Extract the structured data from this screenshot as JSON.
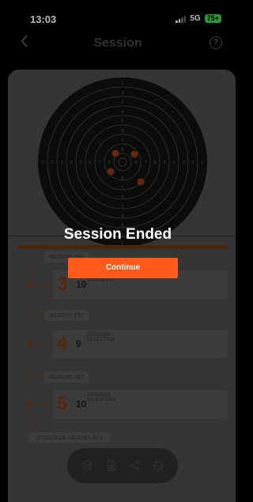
{
  "status_bar": {
    "time": "13:03",
    "network": "5G",
    "battery": "75+"
  },
  "header": {
    "title": "Session",
    "back_icon": "chevron-left-icon",
    "help_icon": "help-circle-icon",
    "help_glyph": "?"
  },
  "target": {
    "ring_labels": [
      "1",
      "2",
      "3",
      "4",
      "5",
      "6",
      "7",
      "8",
      "9"
    ],
    "impacts": 4
  },
  "timeline": {
    "partial_top_time": "00:00:00.000",
    "shots": [
      {
        "number": "3",
        "score": "10",
        "timestamp": "27/05/2026 13:02:56.271",
        "detail": "-"
      },
      {
        "number": "4",
        "score": "9",
        "timestamp": "27/05/2026 13:02:57.008",
        "detail": "-"
      },
      {
        "number": "5",
        "score": "10",
        "timestamp": "27/05/2026 13:02:57.425",
        "detail": "-"
      }
    ],
    "intervals": [
      "00:00:07.737",
      "00:00:00.417"
    ],
    "final_timestamp": "27/05/2026 13:02:57.473"
  },
  "toolbar": {
    "icons": [
      "layers-icon",
      "document-icon",
      "share-icon",
      "target-icon"
    ]
  },
  "modal": {
    "title": "Session Ended",
    "button_label": "Continue"
  }
}
